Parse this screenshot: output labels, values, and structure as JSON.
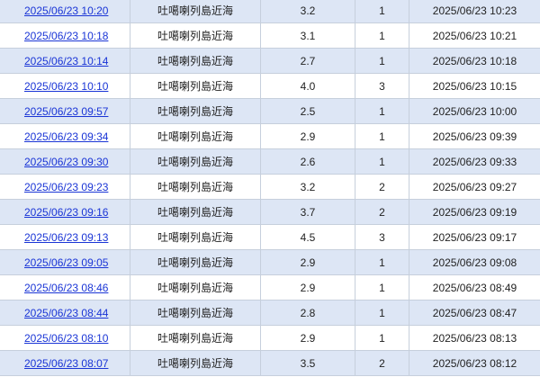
{
  "table": {
    "rows": [
      {
        "time": "2025/06/23 10:20",
        "location": "吐噶喇列島近海",
        "magnitude": "3.2",
        "intensity": "1",
        "announced": "2025/06/23 10:23"
      },
      {
        "time": "2025/06/23 10:18",
        "location": "吐噶喇列島近海",
        "magnitude": "3.1",
        "intensity": "1",
        "announced": "2025/06/23 10:21"
      },
      {
        "time": "2025/06/23 10:14",
        "location": "吐噶喇列島近海",
        "magnitude": "2.7",
        "intensity": "1",
        "announced": "2025/06/23 10:18"
      },
      {
        "time": "2025/06/23 10:10",
        "location": "吐噶喇列島近海",
        "magnitude": "4.0",
        "intensity": "3",
        "announced": "2025/06/23 10:15"
      },
      {
        "time": "2025/06/23 09:57",
        "location": "吐噶喇列島近海",
        "magnitude": "2.5",
        "intensity": "1",
        "announced": "2025/06/23 10:00"
      },
      {
        "time": "2025/06/23 09:34",
        "location": "吐噶喇列島近海",
        "magnitude": "2.9",
        "intensity": "1",
        "announced": "2025/06/23 09:39"
      },
      {
        "time": "2025/06/23 09:30",
        "location": "吐噶喇列島近海",
        "magnitude": "2.6",
        "intensity": "1",
        "announced": "2025/06/23 09:33"
      },
      {
        "time": "2025/06/23 09:23",
        "location": "吐噶喇列島近海",
        "magnitude": "3.2",
        "intensity": "2",
        "announced": "2025/06/23 09:27"
      },
      {
        "time": "2025/06/23 09:16",
        "location": "吐噶喇列島近海",
        "magnitude": "3.7",
        "intensity": "2",
        "announced": "2025/06/23 09:19"
      },
      {
        "time": "2025/06/23 09:13",
        "location": "吐噶喇列島近海",
        "magnitude": "4.5",
        "intensity": "3",
        "announced": "2025/06/23 09:17"
      },
      {
        "time": "2025/06/23 09:05",
        "location": "吐噶喇列島近海",
        "magnitude": "2.9",
        "intensity": "1",
        "announced": "2025/06/23 09:08"
      },
      {
        "time": "2025/06/23 08:46",
        "location": "吐噶喇列島近海",
        "magnitude": "2.9",
        "intensity": "1",
        "announced": "2025/06/23 08:49"
      },
      {
        "time": "2025/06/23 08:44",
        "location": "吐噶喇列島近海",
        "magnitude": "2.8",
        "intensity": "1",
        "announced": "2025/06/23 08:47"
      },
      {
        "time": "2025/06/23 08:10",
        "location": "吐噶喇列島近海",
        "magnitude": "2.9",
        "intensity": "1",
        "announced": "2025/06/23 08:13"
      },
      {
        "time": "2025/06/23 08:07",
        "location": "吐噶喇列島近海",
        "magnitude": "3.5",
        "intensity": "2",
        "announced": "2025/06/23 08:12"
      }
    ]
  },
  "colors": {
    "row_shaded": "#dde6f5",
    "row_plain": "#ffffff",
    "link": "#1a35d6",
    "border": "#c6cfdc"
  }
}
